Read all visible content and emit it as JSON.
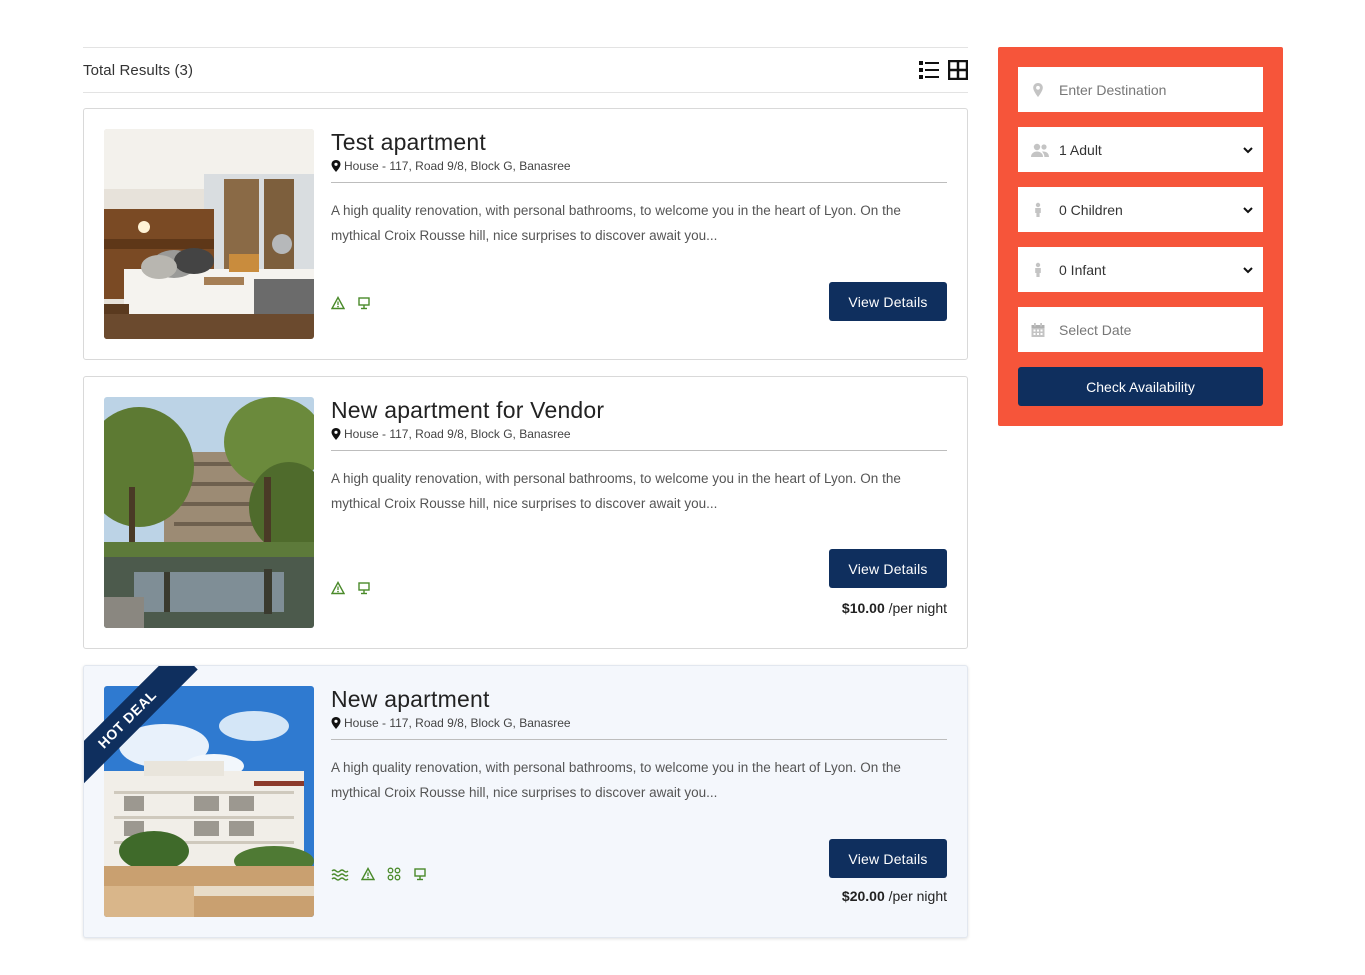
{
  "results": {
    "total_label": "Total Results",
    "total_count": "(3)",
    "view_list_icon": "list-view-icon",
    "view_grid_icon": "grid-view-icon"
  },
  "listings": [
    {
      "title": "Test apartment",
      "address": "House - 117, Road 9/8, Block G, Banasree",
      "description": "A high quality renovation, with personal bathrooms, to welcome you in the heart of Lyon. On the mythical Croix Rousse hill, nice surprises to discover await you...",
      "button_label": "View Details",
      "price": "",
      "price_unit": "",
      "badge": "",
      "amenity_icons": [
        "warning-icon",
        "tv-icon"
      ]
    },
    {
      "title": "New apartment for Vendor",
      "address": "House - 117, Road 9/8, Block G, Banasree",
      "description": "A high quality renovation, with personal bathrooms, to welcome you in the heart of Lyon. On the mythical Croix Rousse hill, nice surprises to discover await you...",
      "button_label": "View Details",
      "price": "$10.00",
      "price_unit": "/per night",
      "badge": "",
      "amenity_icons": [
        "warning-icon",
        "tv-icon"
      ]
    },
    {
      "title": "New apartment",
      "address": "House - 117, Road 9/8, Block G, Banasree",
      "description": "A high quality renovation, with personal bathrooms, to welcome you in the heart of Lyon. On the mythical Croix Rousse hill, nice surprises to discover await you...",
      "button_label": "View Details",
      "price": "$20.00",
      "price_unit": "/per night",
      "badge": "HOT DEAL",
      "amenity_icons": [
        "pool-icon",
        "warning-icon",
        "command-icon",
        "tv-icon"
      ]
    }
  ],
  "search": {
    "destination_placeholder": "Enter Destination",
    "adults": "1 Adult",
    "children": "0 Children",
    "infants": "0 Infant",
    "date_placeholder": "Select Date",
    "button_label": "Check Availability"
  },
  "colors": {
    "primary": "#0f2f5e",
    "search_bg": "#f6553a",
    "amenity": "#4a8a2a",
    "highlight_bg": "#f4f7fc"
  }
}
